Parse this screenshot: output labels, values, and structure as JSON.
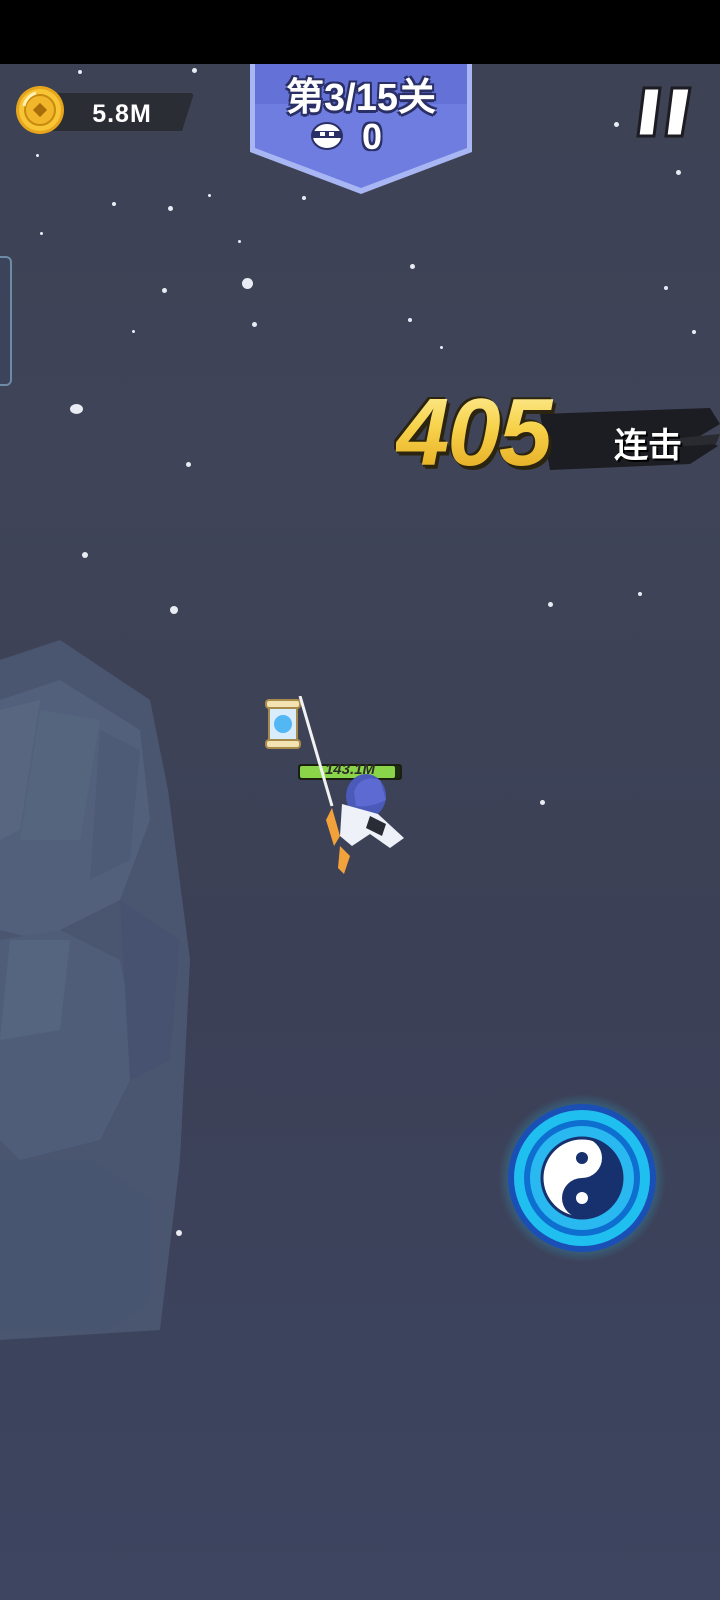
{
  "hud": {
    "coins": "5.8M",
    "level_label": "第3/15关",
    "kills": "0"
  },
  "combo": {
    "count": "405",
    "label": "连击"
  },
  "player": {
    "hp_label": "143.1M",
    "hp_fraction": 0.95
  },
  "icons": {
    "coin": "gold-coin-icon",
    "ninja_head": "ninja-head-icon",
    "pause": "pause-icon",
    "skill": "yin-yang-icon",
    "scroll": "magic-scroll-icon"
  },
  "colors": {
    "background": "#3e4256",
    "banner": "#6b78d8",
    "combo_gold": "#f2c23a",
    "hp_green": "#8ad44a",
    "skill_glow": "#2ad0f5"
  }
}
